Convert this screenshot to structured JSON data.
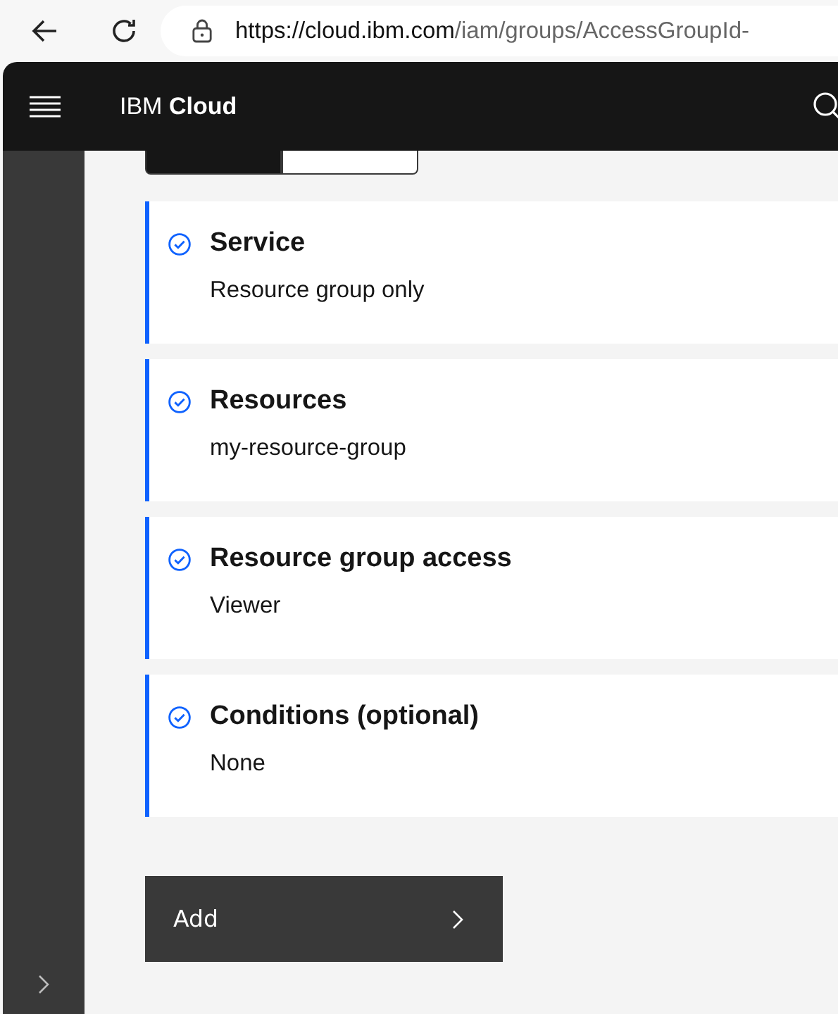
{
  "browser": {
    "url_host": "https://cloud.ibm.com",
    "url_path": "/iam/groups/AccessGroupId-"
  },
  "header": {
    "brand_light": "IBM",
    "brand_bold": "Cloud"
  },
  "view_switch": [
    {
      "selected": true
    },
    {
      "selected": false
    }
  ],
  "sections": [
    {
      "title": "Service",
      "value": "Resource group only",
      "complete": true
    },
    {
      "title": "Resources",
      "value": "my-resource-group",
      "complete": true
    },
    {
      "title": "Resource group access",
      "value": "Viewer",
      "complete": true
    },
    {
      "title": "Conditions (optional)",
      "value": "None",
      "complete": true
    }
  ],
  "add_button": {
    "label": "Add"
  }
}
